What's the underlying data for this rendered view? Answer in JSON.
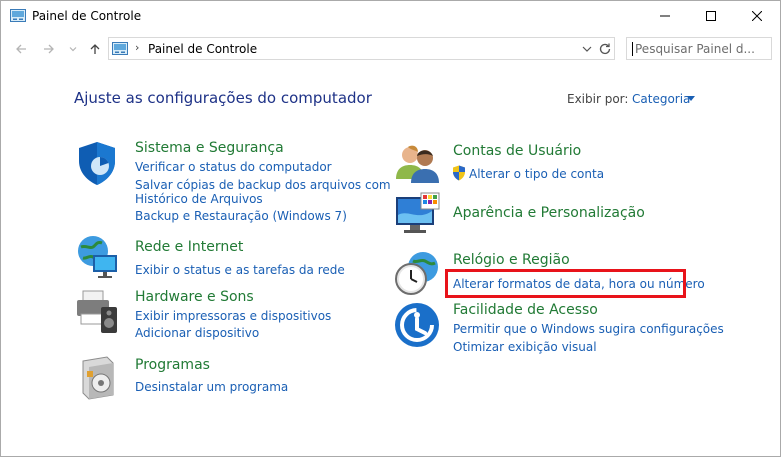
{
  "window": {
    "title": "Painel de Controle",
    "title_icon": "control-panel-icon",
    "buttons": [
      "minimize-icon",
      "maximize-icon",
      "close-icon"
    ]
  },
  "address_bar": {
    "path": "Painel de Controle",
    "search_placeholder": "Pesquisar Painel d..."
  },
  "main": {
    "heading": "Ajuste as configurações do computador",
    "view_by_label": "Exibir por:",
    "view_by_value": "Categoria"
  },
  "categories": {
    "sistema": {
      "icon": "shield-icon",
      "title": "Sistema e Segurança",
      "links": [
        "Verificar o status do computador",
        "Salvar cópias de backup dos arquivos com",
        "Histórico de Arquivos",
        "Backup e Restauração (Windows 7)"
      ]
    },
    "rede": {
      "icon": "network-globe-icon",
      "title": "Rede e Internet",
      "links": [
        "Exibir o status e as tarefas da rede"
      ]
    },
    "hardware": {
      "icon": "printer-speaker-icon",
      "title": "Hardware e Sons",
      "links": [
        "Exibir impressoras e dispositivos",
        "Adicionar dispositivo"
      ]
    },
    "programas": {
      "icon": "programs-box-icon",
      "title": "Programas",
      "links": [
        "Desinstalar um programa"
      ]
    },
    "contas": {
      "icon": "users-icon",
      "title": "Contas de Usuário",
      "links": [
        "Alterar o tipo de conta"
      ],
      "link_icon": "uac-shield-icon"
    },
    "aparencia": {
      "icon": "monitor-palette-icon",
      "title": "Aparência e Personalização",
      "links": []
    },
    "relogio": {
      "icon": "clock-globe-icon",
      "title": "Relógio e Região",
      "links": [
        "Alterar formatos de data, hora ou número"
      ]
    },
    "acesso": {
      "icon": "ease-of-access-icon",
      "title": "Facilidade de Acesso",
      "links": [
        "Permitir que o Windows sugira configurações",
        "Otimizar exibição visual"
      ]
    }
  },
  "annotation": {
    "highlight_color": "#e8131a"
  }
}
